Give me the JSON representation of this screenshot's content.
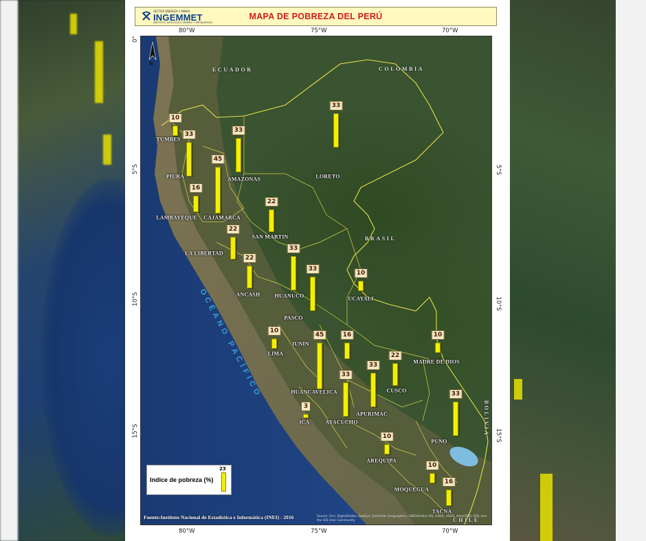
{
  "header": {
    "org_name": "INGEMMET",
    "org_top": "SECTOR ENERGÍA Y MINAS",
    "org_sub": "INSTITUTO GEOLÓGICO, MINERO Y METALÚRGICO",
    "title": "MAPA DE POBREZA DEL PERÚ"
  },
  "axes": {
    "top": [
      "80°W",
      "75°W",
      "70°W"
    ],
    "bottom": [
      "80°W",
      "75°W",
      "70°W"
    ],
    "left": [
      "0°",
      "5°S",
      "10°S",
      "15°S"
    ],
    "right": [
      "5°S",
      "10°S",
      "15°S"
    ]
  },
  "countries": {
    "ecuador": "ECUADOR",
    "colombia": "COLOMBIA",
    "brasil": "BRASIL",
    "bolivia": "BOLIVIA",
    "chile": "CHILE"
  },
  "ocean": "OCÉANO PACÍFICO",
  "regions": [
    {
      "name": "TUMBES",
      "value": 10
    },
    {
      "name": "PIURA",
      "value": 33
    },
    {
      "name": "LAMBAYEQUE",
      "value": 16
    },
    {
      "name": "CAJAMARCA",
      "value": 45
    },
    {
      "name": "AMAZONAS",
      "value": 33
    },
    {
      "name": "LORETO",
      "value": 33
    },
    {
      "name": "SAN MARTIN",
      "value": 22
    },
    {
      "name": "LA LIBERTAD",
      "value": 22
    },
    {
      "name": "ANCASH",
      "value": 22
    },
    {
      "name": "HUANUCO",
      "value": 33
    },
    {
      "name": "PASCO",
      "value": 33
    },
    {
      "name": "UCAYALI",
      "value": 10
    },
    {
      "name": "LIMA",
      "value": 10
    },
    {
      "name": "JUNIN",
      "value": 45
    },
    {
      "name": "HUANCAVELICA",
      "value": 16
    },
    {
      "name": "MADRE DE DIOS",
      "value": 10
    },
    {
      "name": "CUSCO",
      "value": 22
    },
    {
      "name": "APURIMAC",
      "value": 33
    },
    {
      "name": "AYACUCHO",
      "value": 33
    },
    {
      "name": "ICA",
      "value": 3
    },
    {
      "name": "PUNO",
      "value": 33
    },
    {
      "name": "AREQUIPA",
      "value": 10
    },
    {
      "name": "MOQUEGUA",
      "value": 10
    },
    {
      "name": "TACNA",
      "value": 16
    }
  ],
  "legend": {
    "label": "Indice de pobreza (%)",
    "sample_value": "23"
  },
  "source": "Fuente:Instituto Nacional de Estadística e Informática (INEI) - 2016",
  "credits": "Source: Esri, DigitalGlobe, GeoEye, Earthstar Geographics, CNES/Airbus DS, USDA, USGS, AeroGRID, IGN, and the GIS User Community",
  "colors": {
    "bar": "#f2f000",
    "title": "#d11a1a",
    "boundary": "#e6e24a",
    "ocean": "#1c3f78"
  }
}
